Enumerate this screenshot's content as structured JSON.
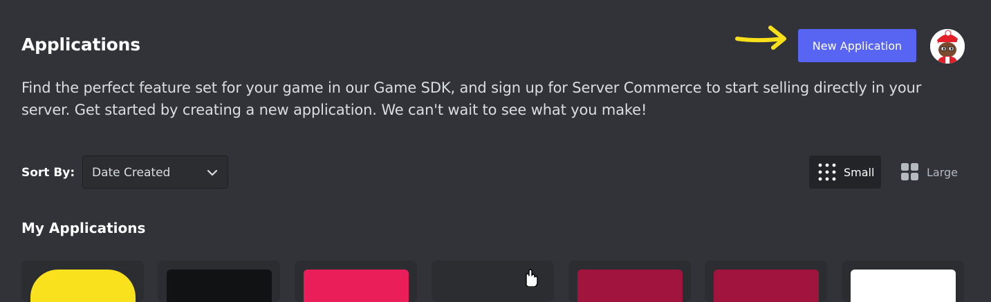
{
  "header": {
    "title": "Applications",
    "description": "Find the perfect feature set for your game in our Game SDK, and sign up for Server Commerce to start selling directly in your server. Get started by creating a new application. We can't wait to see what you make!",
    "new_application_label": "New Application",
    "arrow_color": "#f7e01a"
  },
  "user": {
    "avatar_icon": "avatar-icon"
  },
  "sort": {
    "label": "Sort By:",
    "selected": "Date Created"
  },
  "view": {
    "small_label": "Small",
    "large_label": "Large",
    "selected": "Small"
  },
  "section": {
    "title": "My Applications"
  },
  "applications": [
    {
      "color": "#f9e11e"
    },
    {
      "color": "#111214"
    },
    {
      "color": "#ea1f5a"
    },
    {
      "color": "#2b2d31"
    },
    {
      "color": "#a1143e"
    },
    {
      "color": "#a1143e"
    },
    {
      "color": "#ffffff"
    }
  ],
  "colors": {
    "background": "#313338",
    "accent": "#5865f2"
  }
}
